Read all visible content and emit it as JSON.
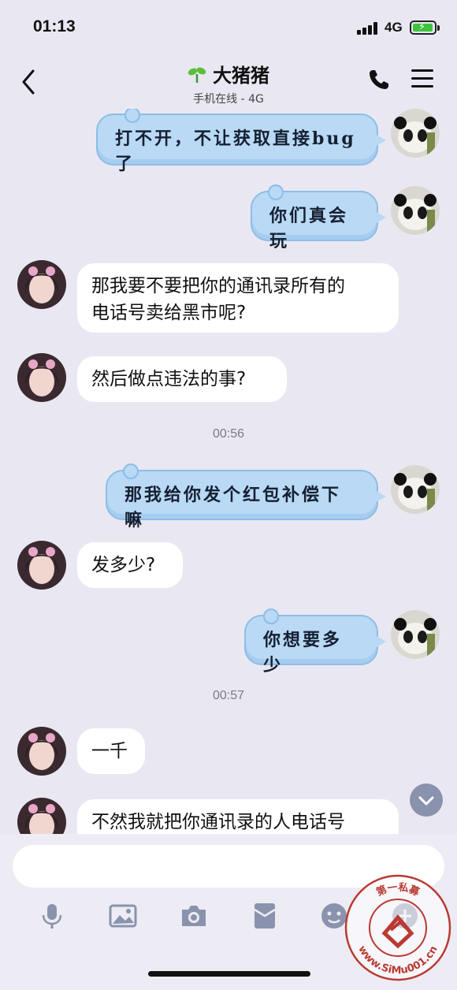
{
  "status_bar": {
    "time": "01:13",
    "network": "4G"
  },
  "header": {
    "contact_name": "大猪猪",
    "contact_status": "手机在线 - 4G"
  },
  "messages": [
    {
      "side": "right",
      "text": "打不开，不让获取直接bug了"
    },
    {
      "side": "right",
      "text": "你们真会玩"
    },
    {
      "side": "left",
      "lines": [
        "那我要不要把你的通讯录所有的",
        "电话号卖给黑市呢?"
      ]
    },
    {
      "side": "left",
      "text": "然后做点违法的事?"
    },
    {
      "timestamp": "00:56"
    },
    {
      "side": "right",
      "text": "那我给你发个红包补偿下嘛"
    },
    {
      "side": "left",
      "text": "发多少?"
    },
    {
      "side": "right",
      "text": "你想要多少"
    },
    {
      "timestamp": "00:57"
    },
    {
      "side": "left",
      "text": "一千"
    },
    {
      "side": "left",
      "text": "不然我就把你通讯录的人电话号"
    }
  ],
  "input": {
    "placeholder": ""
  },
  "watermark": {
    "top_text": "第一私募",
    "bottom_text": "www.SiMu001.cn"
  },
  "colors": {
    "background": "#e9e8f2",
    "right_bubble": "#b9d9f5",
    "left_bubble": "#ffffff",
    "watermark": "#b93a32"
  }
}
